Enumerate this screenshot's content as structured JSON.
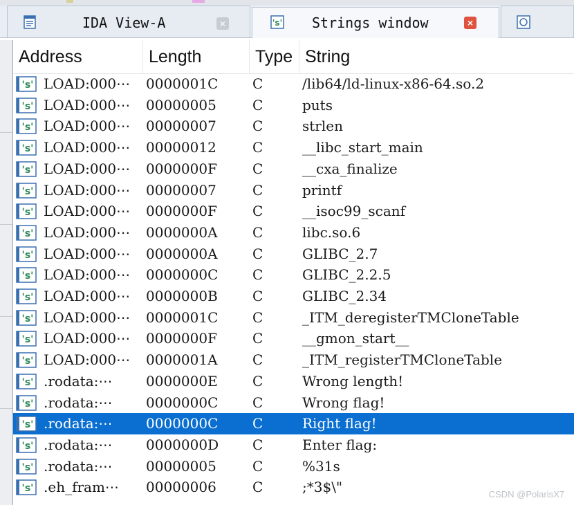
{
  "tabs": [
    {
      "label": "IDA View-A",
      "icon": "ida-view-icon",
      "active": false,
      "close_icon": "close-icon"
    },
    {
      "label": "Strings window",
      "icon": "strings-icon",
      "active": true,
      "close_icon": "close-icon"
    },
    {
      "label": "",
      "icon": "hex-view-icon",
      "active": false
    }
  ],
  "close_glyph": "×",
  "columns": {
    "address": "Address",
    "length": "Length",
    "type": "Type",
    "string": "String"
  },
  "row_icon_label": "'s'",
  "rows": [
    {
      "address": "LOAD:000⋯",
      "length": "0000001C",
      "type": "C",
      "string": "/lib64/ld-linux-x86-64.so.2"
    },
    {
      "address": "LOAD:000⋯",
      "length": "00000005",
      "type": "C",
      "string": "puts"
    },
    {
      "address": "LOAD:000⋯",
      "length": "00000007",
      "type": "C",
      "string": "strlen"
    },
    {
      "address": "LOAD:000⋯",
      "length": "00000012",
      "type": "C",
      "string": "__libc_start_main"
    },
    {
      "address": "LOAD:000⋯",
      "length": "0000000F",
      "type": "C",
      "string": "__cxa_finalize"
    },
    {
      "address": "LOAD:000⋯",
      "length": "00000007",
      "type": "C",
      "string": "printf"
    },
    {
      "address": "LOAD:000⋯",
      "length": "0000000F",
      "type": "C",
      "string": "__isoc99_scanf"
    },
    {
      "address": "LOAD:000⋯",
      "length": "0000000A",
      "type": "C",
      "string": "libc.so.6"
    },
    {
      "address": "LOAD:000⋯",
      "length": "0000000A",
      "type": "C",
      "string": "GLIBC_2.7"
    },
    {
      "address": "LOAD:000⋯",
      "length": "0000000C",
      "type": "C",
      "string": "GLIBC_2.2.5"
    },
    {
      "address": "LOAD:000⋯",
      "length": "0000000B",
      "type": "C",
      "string": "GLIBC_2.34"
    },
    {
      "address": "LOAD:000⋯",
      "length": "0000001C",
      "type": "C",
      "string": "_ITM_deregisterTMCloneTable"
    },
    {
      "address": "LOAD:000⋯",
      "length": "0000000F",
      "type": "C",
      "string": "__gmon_start__"
    },
    {
      "address": "LOAD:000⋯",
      "length": "0000001A",
      "type": "C",
      "string": "_ITM_registerTMCloneTable"
    },
    {
      "address": ".rodata:⋯",
      "length": "0000000E",
      "type": "C",
      "string": "Wrong length!"
    },
    {
      "address": ".rodata:⋯",
      "length": "0000000C",
      "type": "C",
      "string": "Wrong flag!"
    },
    {
      "address": ".rodata:⋯",
      "length": "0000000C",
      "type": "C",
      "string": "Right flag!",
      "selected": true
    },
    {
      "address": ".rodata:⋯",
      "length": "0000000D",
      "type": "C",
      "string": "Enter flag:"
    },
    {
      "address": ".rodata:⋯",
      "length": "00000005",
      "type": "C",
      "string": "%31s"
    },
    {
      "address": ".eh_fram⋯",
      "length": "00000006",
      "type": "C",
      "string": ";*3$\\\""
    }
  ],
  "watermark": "CSDN @PolarisX7",
  "colors": {
    "selection": "#0a6fd0",
    "string_icon": "#2e8b57",
    "close_active": "#e0533f"
  }
}
